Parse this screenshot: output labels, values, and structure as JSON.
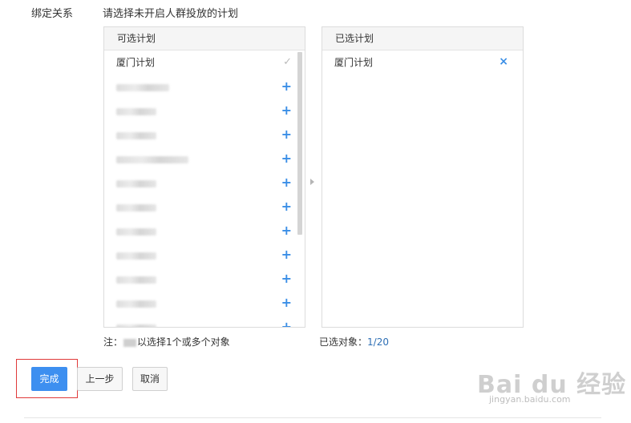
{
  "form": {
    "binding_label": "绑定关系",
    "instruction": "请选择未开启人群投放的计划"
  },
  "available": {
    "header": "可选计划",
    "items": [
      {
        "name": "厦门计划",
        "state": "selected"
      },
      {
        "name": "",
        "state": "add"
      },
      {
        "name": "",
        "state": "add"
      },
      {
        "name": "",
        "state": "add"
      },
      {
        "name": "",
        "state": "add"
      },
      {
        "name": "",
        "state": "add"
      },
      {
        "name": "",
        "state": "add"
      },
      {
        "name": "",
        "state": "add"
      },
      {
        "name": "",
        "state": "add"
      },
      {
        "name": "",
        "state": "add"
      },
      {
        "name": "",
        "state": "add"
      },
      {
        "name": "",
        "state": "add"
      }
    ],
    "add_glyph": "+",
    "check_glyph": "✓"
  },
  "selected": {
    "header": "已选计划",
    "items": [
      {
        "name": "厦门计划"
      }
    ],
    "remove_glyph": "×"
  },
  "footer": {
    "note_prefix": "注：",
    "note_suffix": "以选择1个或多个对象",
    "selected_count_label": "已选对象：",
    "selected_count_value": "1/20"
  },
  "buttons": {
    "done": "完成",
    "prev": "上一步",
    "cancel": "取消"
  },
  "watermark": {
    "logo": "Bai du 经验",
    "url": "jingyan.baidu.com"
  },
  "colors": {
    "accent": "#3d8ff0",
    "highlight": "#e03a3a"
  }
}
